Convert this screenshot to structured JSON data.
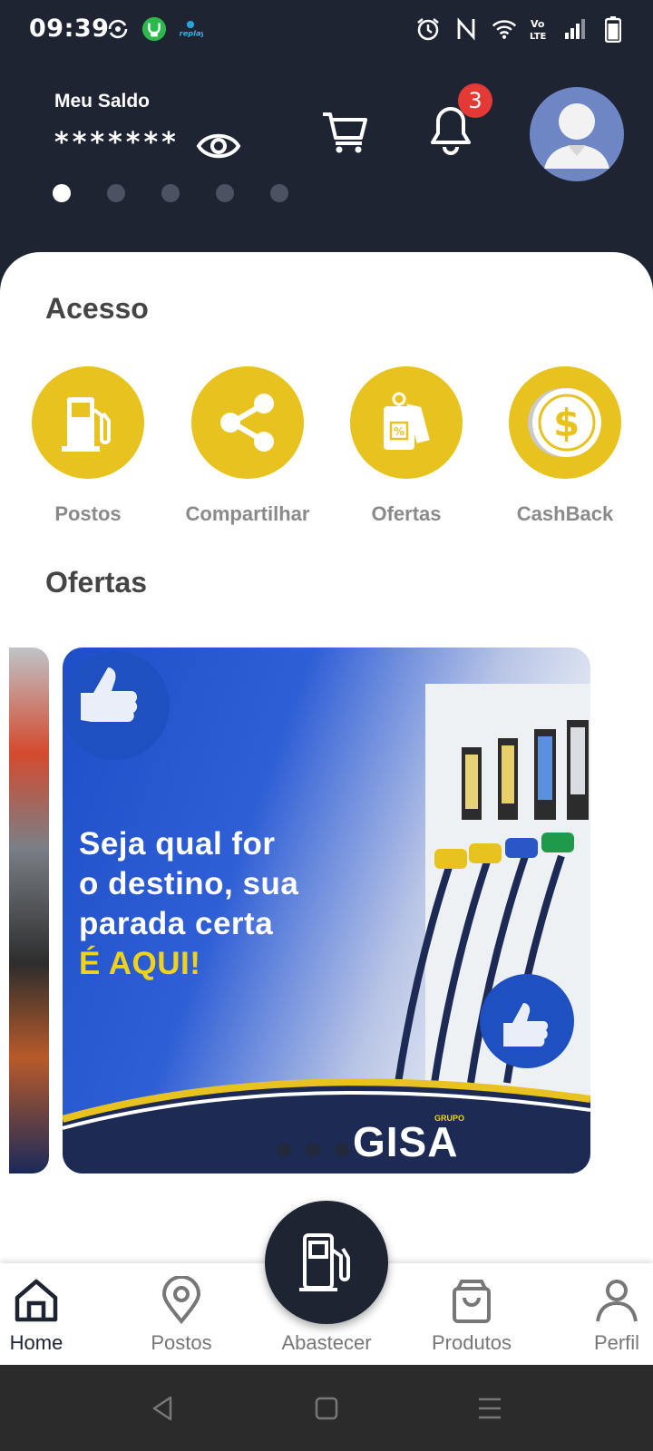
{
  "status_bar": {
    "time": "09:39",
    "left_icons": [
      "sync-icon",
      "app-notification-icon",
      "replay-icon"
    ],
    "right_icons": [
      "alarm-icon",
      "nfc-icon",
      "wifi-icon",
      "volte-icon",
      "signal-icon",
      "battery-icon"
    ],
    "volte_text": "Vo LTE"
  },
  "header": {
    "balance_label": "Meu Saldo",
    "balance_value": "*******",
    "notification_count": "3",
    "carousel_page_count": 5,
    "carousel_active_index": 0
  },
  "access": {
    "title": "Acesso",
    "items": [
      {
        "label": "Postos",
        "icon": "fuel-pump-icon"
      },
      {
        "label": "Compartilhar",
        "icon": "share-icon"
      },
      {
        "label": "Ofertas",
        "icon": "price-tags-icon"
      },
      {
        "label": "CashBack",
        "icon": "dollar-coin-icon"
      }
    ]
  },
  "offers": {
    "title": "Ofertas",
    "banner": {
      "line1": "Seja qual for",
      "line2": "o destino, sua",
      "line3": "parada certa",
      "line4": "É AQUI!",
      "brand": "GISA",
      "brand_sub": "GRUPO"
    }
  },
  "bottom_nav": {
    "items": [
      {
        "label": "Home",
        "icon": "home-icon",
        "active": true
      },
      {
        "label": "Postos",
        "icon": "location-pin-icon",
        "active": false
      },
      {
        "label": "Abastecer",
        "icon": "fuel-pump-icon",
        "active": false
      },
      {
        "label": "Produtos",
        "icon": "shopping-bag-icon",
        "active": false
      },
      {
        "label": "Perfil",
        "icon": "person-icon",
        "active": false
      }
    ]
  },
  "colors": {
    "header_bg": "#1f2433",
    "accent_yellow": "#e8c320",
    "badge_red": "#e53935",
    "avatar_bg": "#6f86c4"
  }
}
